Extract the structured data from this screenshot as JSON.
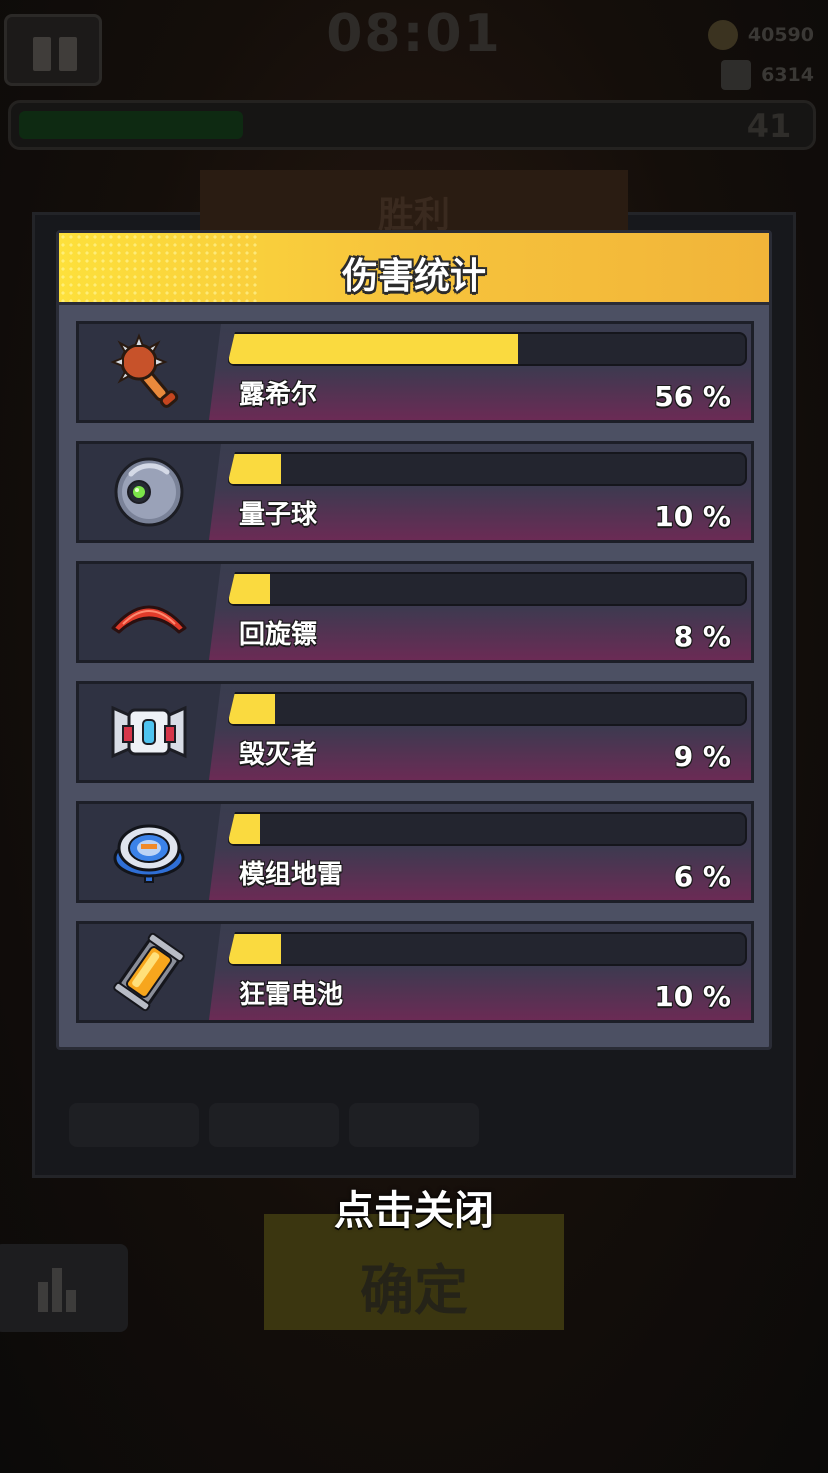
{
  "background": {
    "timer": "08:01",
    "coins": "40590",
    "kills": "6314",
    "level": "41",
    "xp_progress": 0.32,
    "victory_title": "胜利",
    "confirm_label": "确定"
  },
  "damage_stats": {
    "title": "伤害统计",
    "items": [
      {
        "icon": "spiked-club-icon",
        "name": "露希尔",
        "percent": 56,
        "percent_label": "56 %"
      },
      {
        "icon": "quantum-orb-icon",
        "name": "量子球",
        "percent": 10,
        "percent_label": "10 %"
      },
      {
        "icon": "boomerang-icon",
        "name": "回旋镖",
        "percent": 8,
        "percent_label": "8 %"
      },
      {
        "icon": "destroyer-drone-icon",
        "name": "毁灭者",
        "percent": 9,
        "percent_label": "9 %"
      },
      {
        "icon": "modular-mine-icon",
        "name": "模组地雷",
        "percent": 6,
        "percent_label": "6 %"
      },
      {
        "icon": "thunder-battery-icon",
        "name": "狂雷电池",
        "percent": 10,
        "percent_label": "10 %"
      }
    ]
  },
  "close_hint": "点击关闭",
  "colors": {
    "accent_yellow": "#fada3f",
    "header_yellow": "#f7c53c",
    "panel_bg": "#4c5063",
    "row_bg": "#2f3242",
    "magenta_fade": "#6b2b55"
  }
}
